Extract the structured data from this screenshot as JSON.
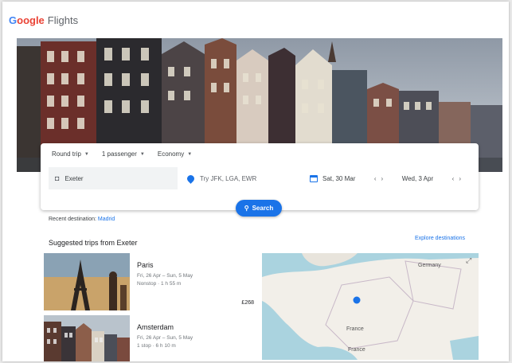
{
  "header": {
    "logo_text": "oogle",
    "logo_colored_prefix": "G",
    "product": "Flights"
  },
  "search": {
    "trip_type": "Round trip",
    "passengers": "1 passenger",
    "cabin": "Economy",
    "from": "Exeter",
    "to_placeholder": "Try JFK, LGA, EWR",
    "depart": "Sat, 30 Mar",
    "return": "Wed, 3 Apr",
    "search_label": "Search"
  },
  "recent": {
    "label": "Recent destination:",
    "city": "Madrid"
  },
  "suggested": {
    "title": "Suggested trips from Exeter",
    "explore_label": "Explore destinations",
    "trips": [
      {
        "city": "Paris",
        "dates": "Fri, 26 Apr – Sun, 5 May",
        "details": "Nonstop · 1 h 55 m",
        "price": "£268"
      },
      {
        "city": "Amsterdam",
        "dates": "Fri, 26 Apr – Sun, 5 May",
        "details": "1 stop · 6 h 10 m",
        "price": ""
      }
    ]
  },
  "map": {
    "label_germany": "Germany",
    "label_france": "France",
    "label_france_2": "France"
  },
  "colors": {
    "accent": "#1a73e8",
    "text": "#202124",
    "muted": "#70757a"
  }
}
